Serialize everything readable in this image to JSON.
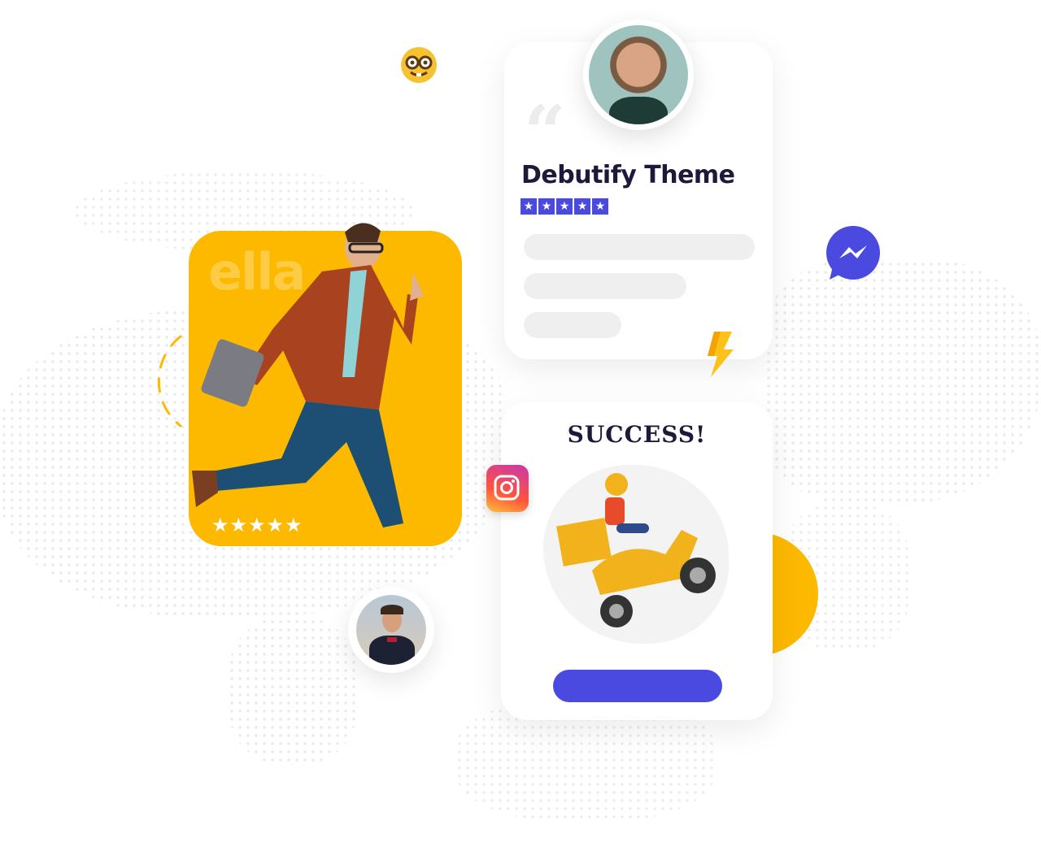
{
  "review_card": {
    "title": "Debutify Theme",
    "rating": 5,
    "quote_mark": "“"
  },
  "hero_card": {
    "watermark": "ella",
    "rating": 5
  },
  "success_card": {
    "title": "SUCCESS!"
  },
  "icons": {
    "emoji": "nerd-face",
    "messenger": "messenger",
    "instagram": "instagram",
    "lightning": "lightning-bolt"
  },
  "colors": {
    "accent_blue": "#4a4ae0",
    "brand_yellow": "#fdb900",
    "title_dark": "#1c1a3a"
  }
}
